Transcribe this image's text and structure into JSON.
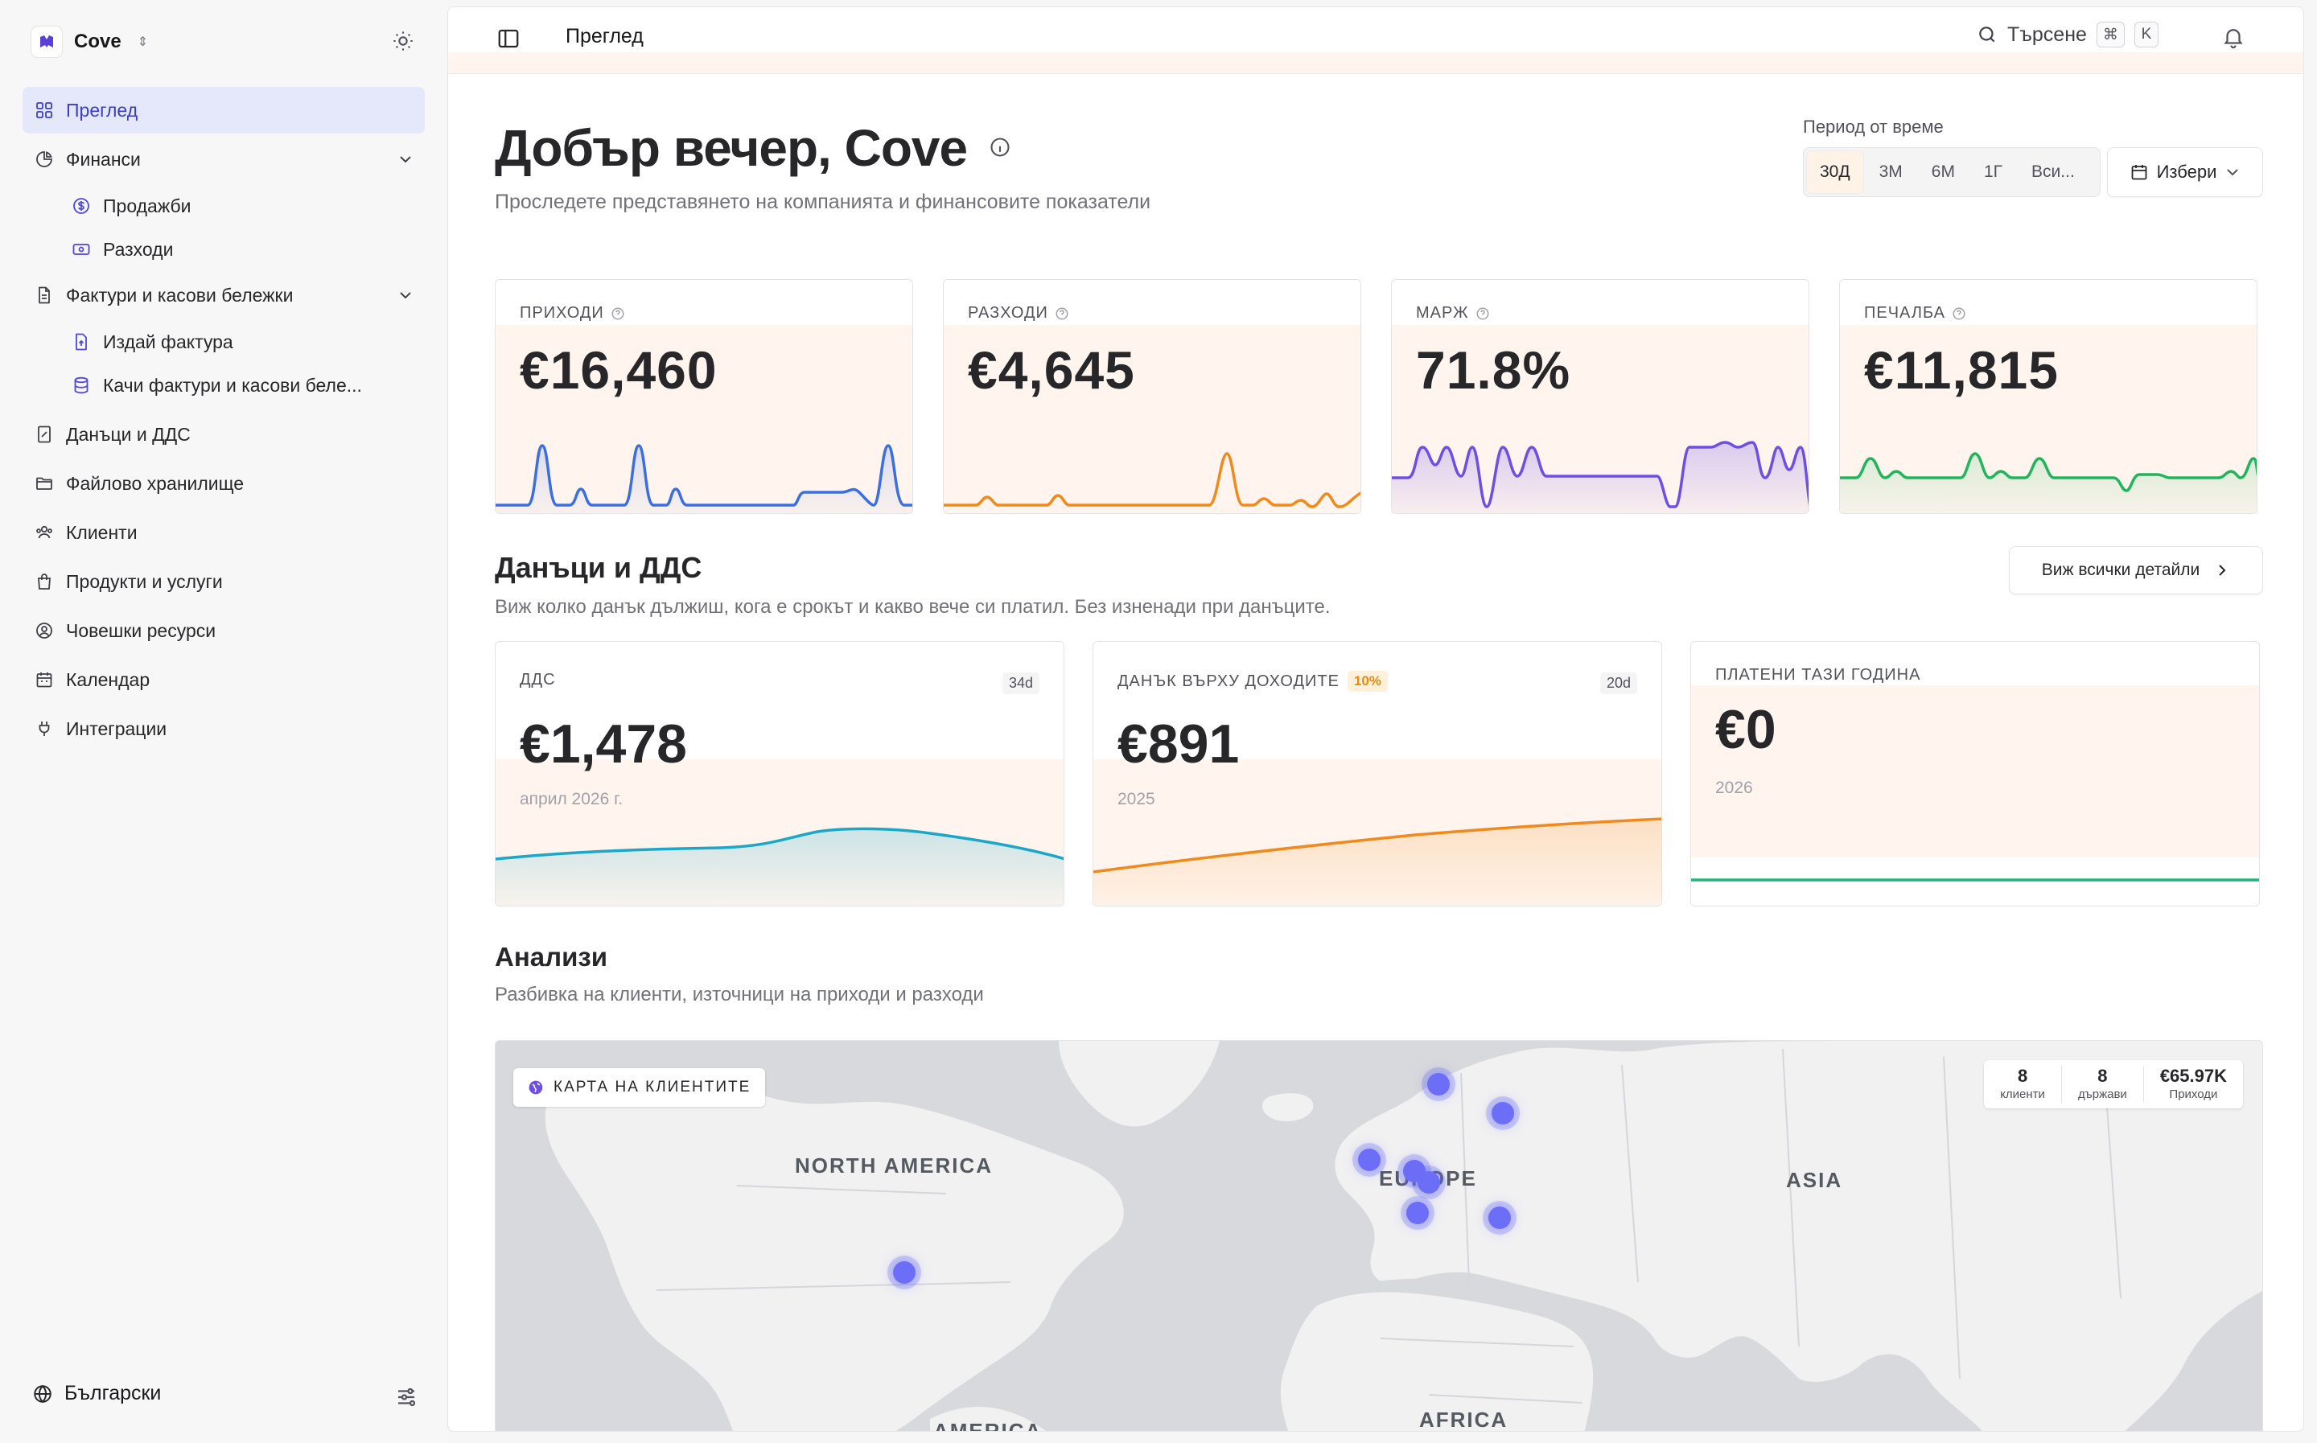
{
  "brand": {
    "name": "Cove"
  },
  "sidebar": {
    "items": [
      {
        "label": "Преглед",
        "icon": "grid-icon",
        "active": true
      },
      {
        "label": "Финанси",
        "icon": "pie-chart-icon",
        "expanded": true
      },
      {
        "label": "Продажби",
        "icon": "dollar-circle-icon",
        "sub": true
      },
      {
        "label": "Разходи",
        "icon": "banknote-icon",
        "sub": true
      },
      {
        "label": "Фактури и касови бележки",
        "icon": "document-icon",
        "expanded": true
      },
      {
        "label": "Издай фактура",
        "icon": "file-upload-icon",
        "sub": true
      },
      {
        "label": "Качи фактури и касови беле...",
        "icon": "database-icon",
        "sub": true
      },
      {
        "label": "Данъци и ДДС",
        "icon": "tax-icon"
      },
      {
        "label": "Файлово хранилище",
        "icon": "folder-icon"
      },
      {
        "label": "Клиенти",
        "icon": "users-icon"
      },
      {
        "label": "Продукти и услуги",
        "icon": "shopping-bag-icon"
      },
      {
        "label": "Човешки ресурси",
        "icon": "user-circle-icon"
      },
      {
        "label": "Календар",
        "icon": "calendar-icon"
      },
      {
        "label": "Интеграции",
        "icon": "plug-icon"
      }
    ],
    "language": "Български"
  },
  "topbar": {
    "breadcrumb": "Преглед",
    "search_label": "Търсене",
    "shortcut_mod": "⌘",
    "shortcut_key": "K"
  },
  "header": {
    "greeting": "Добър вечер, Cove",
    "subtitle": "Проследете представянето на компанията и финансовите показатели",
    "period_label": "Период от време",
    "periods": [
      "30Д",
      "3М",
      "6М",
      "1Г",
      "Вси..."
    ],
    "selected_period": "30Д",
    "pick_label": "Избери"
  },
  "kpis": [
    {
      "label": "ПРИХОДИ",
      "value": "€16,460",
      "color": "#3b6fe0"
    },
    {
      "label": "РАЗХОДИ",
      "value": "€4,645",
      "color": "#f08a1c"
    },
    {
      "label": "МАРЖ",
      "value": "71.8%",
      "color": "#6d4fe6"
    },
    {
      "label": "ПЕЧАЛБА",
      "value": "€11,815",
      "color": "#1fb55a"
    }
  ],
  "taxes_section": {
    "title": "Данъци и ДДС",
    "subtitle": "Виж колко данък дължиш, кога е срокът и какво вече си платил. Без изненади при данъците.",
    "details_button": "Виж всички детайли",
    "cards": [
      {
        "label": "ДДС",
        "days": "34d",
        "value": "€1,478",
        "date": "април 2026 г.",
        "color": "#1aa7c9"
      },
      {
        "label": "ДАНЪК ВЪРХУ ДОХОДИТЕ",
        "rate": "10%",
        "days": "20d",
        "value": "€891",
        "date": "2025",
        "color": "#f08a1c"
      },
      {
        "label": "ПЛАТЕНИ ТАЗИ ГОДИНА",
        "value": "€0",
        "date": "2026",
        "color": "#1fb57a"
      }
    ]
  },
  "analytics": {
    "title": "Анализи",
    "subtitle": "Разбивка на клиенти, източници на приходи и разходи",
    "map_chip": "КАРТА НА КЛИЕНТИТЕ",
    "stats": [
      {
        "value": "8",
        "label": "клиенти"
      },
      {
        "value": "8",
        "label": "държави"
      },
      {
        "value": "€65.97K",
        "label": "Приходи"
      }
    ],
    "regions": [
      "NORTH AMERICA",
      "EUROPE",
      "ASIA",
      "AFRICA",
      "AMERICA"
    ]
  }
}
